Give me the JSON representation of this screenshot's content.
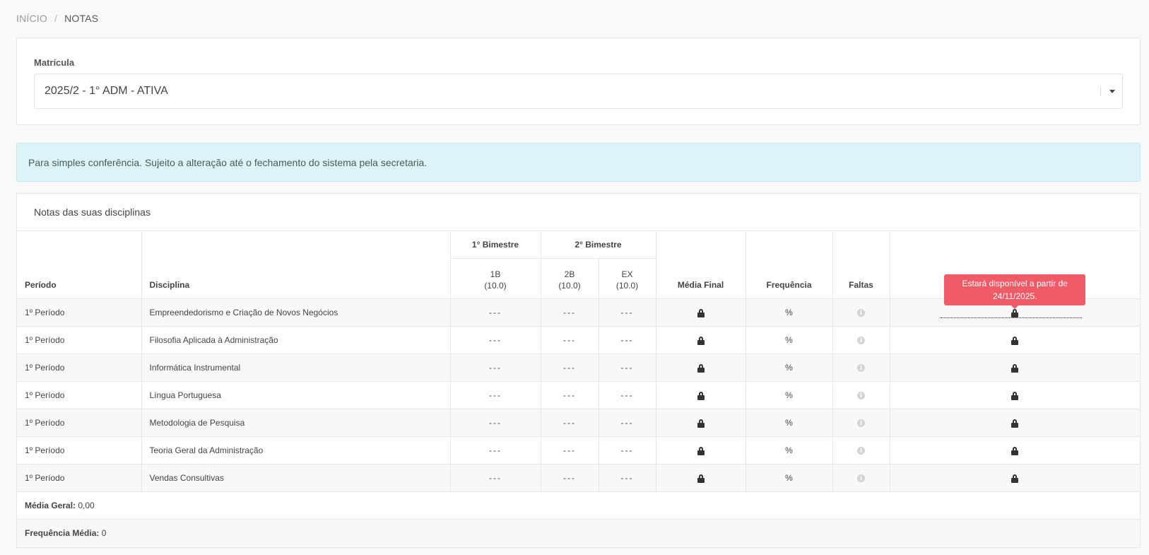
{
  "breadcrumb": {
    "home": "INÍCIO",
    "separator": "/",
    "current": "NOTAS"
  },
  "matricula": {
    "label": "Matrícula",
    "selected": "2025/2 - 1° ADM - ATIVA"
  },
  "alert": {
    "text": "Para simples conferência. Sujeito a alteração até o fechamento do sistema pela secretaria."
  },
  "notas": {
    "title": "Notas das suas disciplinas",
    "headers": {
      "periodo": "Período",
      "disciplina": "Disciplina",
      "bimestre1": "1° Bimestre",
      "bimestre2": "2° Bimestre",
      "b1": "1B",
      "b1_max": "(10.0)",
      "b2": "2B",
      "b2_max": "(10.0)",
      "ex": "EX",
      "ex_max": "(10.0)",
      "media_final": "Média Final",
      "frequencia": "Frequência",
      "faltas": "Faltas"
    },
    "tooltip": "Estará disponível a partir de 24/11/2025.",
    "rows": [
      {
        "periodo": "1º Período",
        "disciplina": "Empreendedorismo e Criação de Novos Negócios",
        "b1": "---",
        "b2": "---",
        "ex": "---",
        "freq": "%"
      },
      {
        "periodo": "1º Período",
        "disciplina": "Filosofia Aplicada à Administração",
        "b1": "---",
        "b2": "---",
        "ex": "---",
        "freq": "%"
      },
      {
        "periodo": "1º Período",
        "disciplina": "Informática Instrumental",
        "b1": "---",
        "b2": "---",
        "ex": "---",
        "freq": "%"
      },
      {
        "periodo": "1º Período",
        "disciplina": "Língua Portuguesa",
        "b1": "---",
        "b2": "---",
        "ex": "---",
        "freq": "%"
      },
      {
        "periodo": "1º Período",
        "disciplina": "Metodologia de Pesquisa",
        "b1": "---",
        "b2": "---",
        "ex": "---",
        "freq": "%"
      },
      {
        "periodo": "1º Período",
        "disciplina": "Teoria Geral da Administração",
        "b1": "---",
        "b2": "---",
        "ex": "---",
        "freq": "%"
      },
      {
        "periodo": "1º Período",
        "disciplina": "Vendas Consultivas",
        "b1": "---",
        "b2": "---",
        "ex": "---",
        "freq": "%"
      }
    ],
    "summary": {
      "media_geral_label": "Média Geral:",
      "media_geral_value": "0,00",
      "frequencia_media_label": "Frequência Média:",
      "frequencia_media_value": "0"
    },
    "icons": {
      "media_final": "lock-icon",
      "faltas": "info-icon",
      "action": "lock-icon"
    }
  },
  "colors": {
    "alert_bg": "#dbf4f7",
    "tooltip_bg": "#f15a67"
  }
}
